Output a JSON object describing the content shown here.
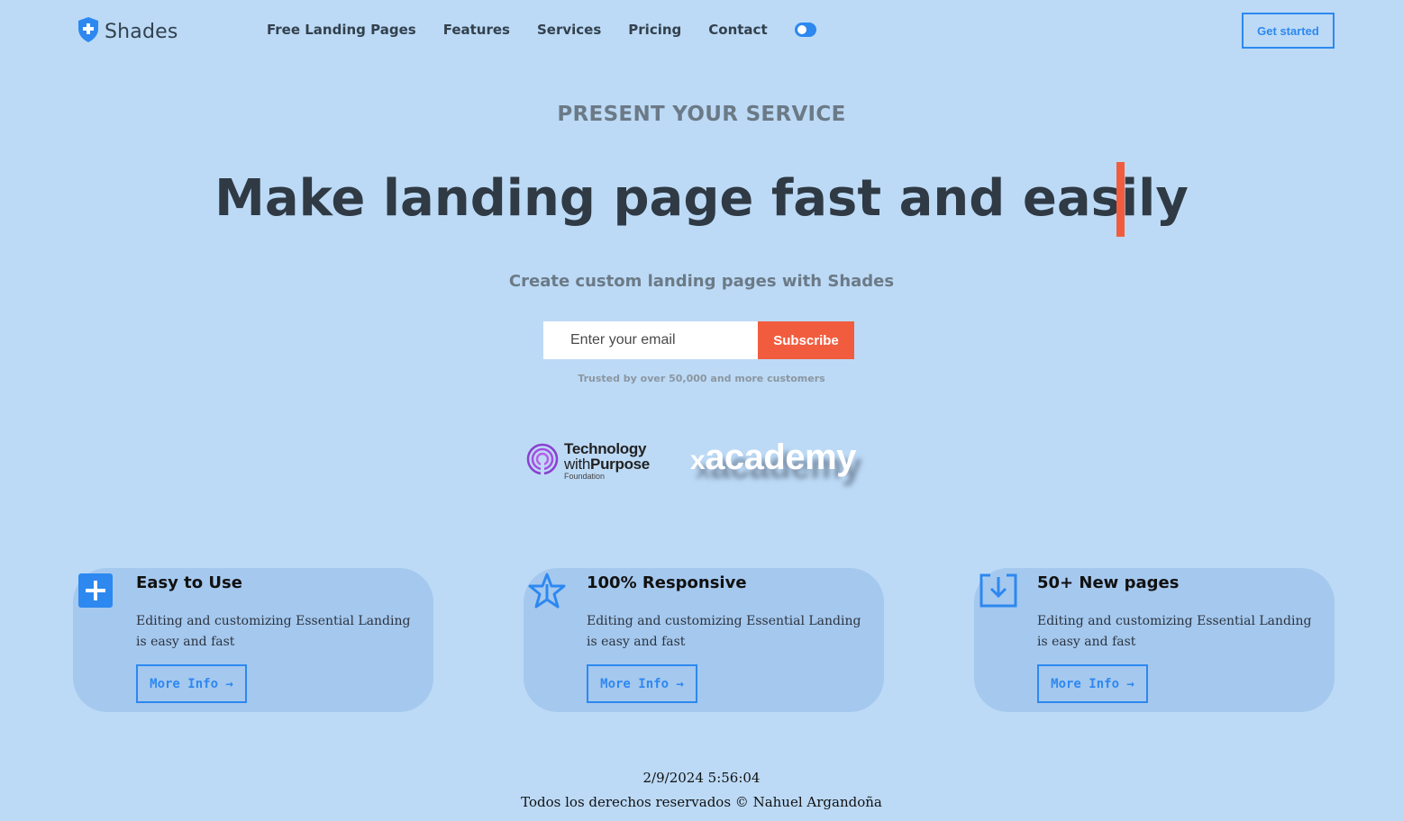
{
  "brand": {
    "name": "Shades",
    "icon": "shield-plus-icon"
  },
  "nav": {
    "links": [
      "Free Landing Pages",
      "Features",
      "Services",
      "Pricing",
      "Contact"
    ],
    "toggle": {
      "icon": "theme-toggle",
      "state": "off"
    },
    "cta_label": "Get started"
  },
  "hero": {
    "eyebrow": "PRESENT YOUR SERVICE",
    "title": "Make landing page fast and easily",
    "subtitle": "Create custom landing pages with Shades",
    "email_placeholder": "Enter your email",
    "subscribe_label": "Subscribe",
    "trusted_text": "Trusted by over 50,000 and more customers"
  },
  "logos": {
    "twp": {
      "line1": "Technology",
      "line2a": "with",
      "line2b": "Purpose",
      "line3": "Foundation"
    },
    "xacademy": {
      "x": "x",
      "rest": "academy"
    }
  },
  "features": [
    {
      "icon": "plus-square-icon",
      "title": "Easy to Use",
      "text": "Editing and customizing Essential Landing is easy and fast",
      "button": "More Info →"
    },
    {
      "icon": "star-icon",
      "title": "100% Responsive",
      "text": "Editing and customizing Essential Landing is easy and fast",
      "button": "More Info →"
    },
    {
      "icon": "download-icon",
      "title": "50+ New pages",
      "text": "Editing and customizing Essential Landing is easy and fast",
      "button": "More Info →"
    }
  ],
  "footer": {
    "datetime": "2/9/2024 5:56:04",
    "copyright": "Todos los derechos reservados © Nahuel Argandoña"
  },
  "colors": {
    "background": "#bcdaf6",
    "accent": "#2d88f0",
    "cta": "#f25c3e",
    "card": "#a5c8ee"
  }
}
